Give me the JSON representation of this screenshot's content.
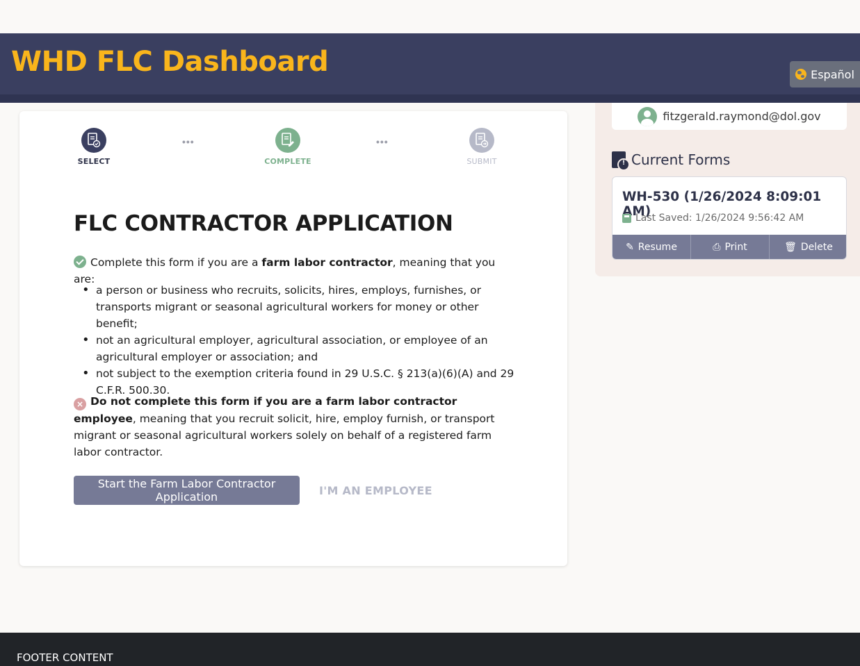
{
  "header": {
    "title": "WHD FLC Dashboard",
    "language_button": "Español",
    "title_color": "#f9b51c",
    "bg_color": "#3a3f60"
  },
  "stepper": {
    "steps": [
      {
        "label": "SELECT",
        "state": "done",
        "color": "#3a3f60",
        "icon": "document-check-icon"
      },
      {
        "label": "COMPLETE",
        "state": "active",
        "color": "#7db18e",
        "icon": "document-edit-icon"
      },
      {
        "label": "SUBMIT",
        "state": "pending",
        "color": "#b6b9c8",
        "icon": "document-send-icon"
      }
    ],
    "separator": "•••"
  },
  "main": {
    "title": "FLC CONTRACTOR APPLICATION",
    "intro_prefix": "Complete this form if you are a ",
    "intro_bold": "farm labor contractor",
    "intro_suffix": ", meaning that you are:",
    "bullets": [
      "a person or business who recruits, solicits, hires, employs, furnishes, or transports migrant or seasonal agricultural workers for money or other benefit;",
      "not an agricultural employer, agricultural association, or employee of an agricultural employer or association; and",
      "not subject to the exemption criteria found in 29 U.S.C. § 213(a)(6)(A) and 29 C.F.R. 500.30."
    ],
    "warning_bold": "Do not complete this form if you are a farm labor contractor employee",
    "warning_rest": ", meaning that you recruit solicit, hire, employ furnish, or transport migrant or seasonal agricultural workers solely on behalf of a registered farm labor contractor.",
    "primary_button": "Start the Farm Labor Contractor Application",
    "secondary_button": "I'M AN EMPLOYEE"
  },
  "sidebar": {
    "user_email": "fitzgerald.raymond@dol.gov",
    "current_forms_heading": "Current Forms",
    "forms": [
      {
        "title": "WH-530 (1/26/2024 8:09:01 AM)",
        "last_saved": "Last Saved: 1/26/2024 9:56:42 AM",
        "actions": {
          "resume": "Resume",
          "print": "Print",
          "delete": "Delete"
        }
      }
    ]
  },
  "footer": {
    "text": "FOOTER CONTENT"
  }
}
